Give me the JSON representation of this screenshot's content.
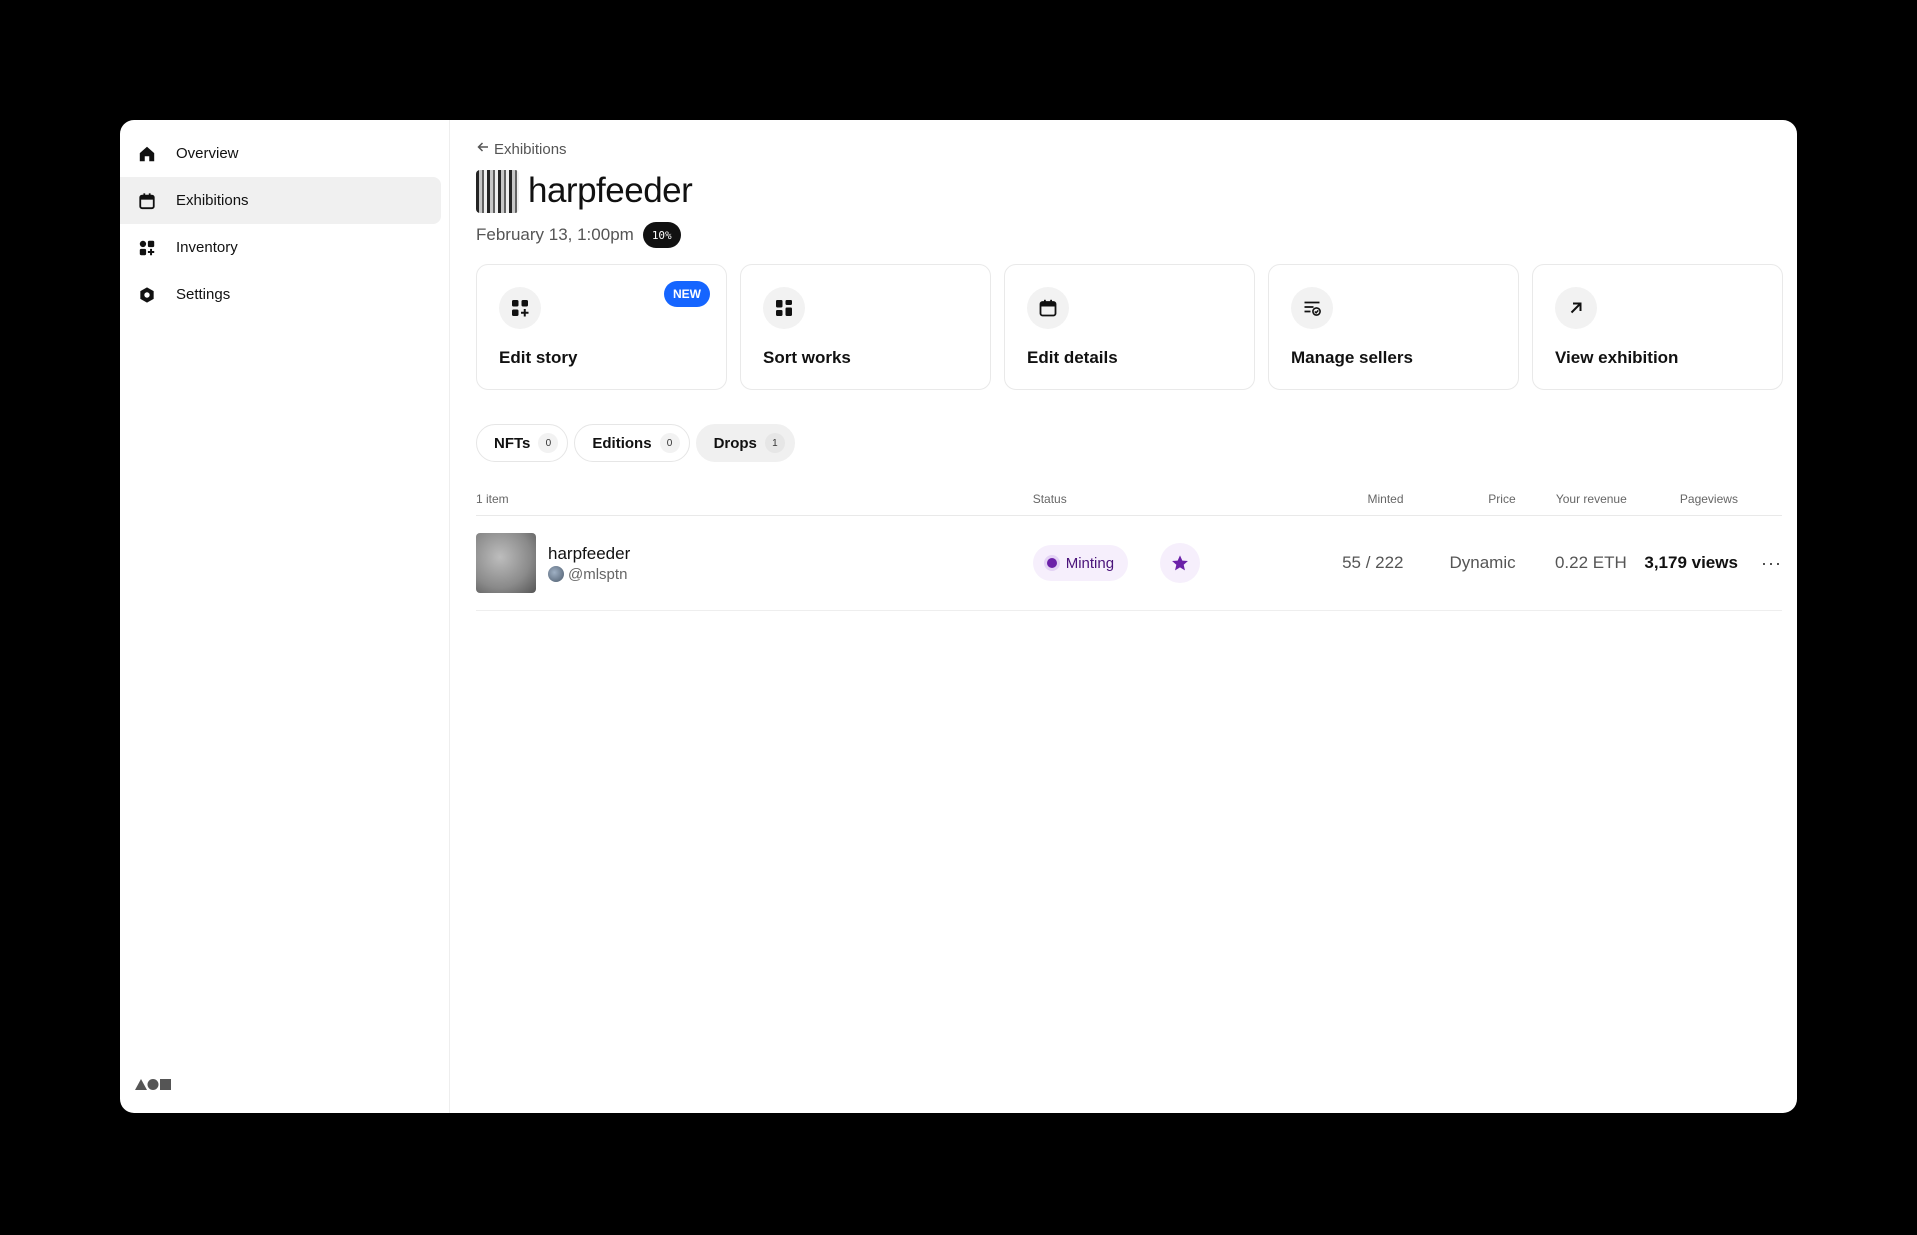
{
  "sidebar": {
    "items": [
      {
        "label": "Overview",
        "icon": "home-icon"
      },
      {
        "label": "Exhibitions",
        "icon": "calendar-icon"
      },
      {
        "label": "Inventory",
        "icon": "grid-icon"
      },
      {
        "label": "Settings",
        "icon": "gear-icon"
      }
    ],
    "active": "Exhibitions"
  },
  "header": {
    "back_label": "Exhibitions",
    "title": "harpfeeder",
    "date": "February 13, 1:00pm",
    "percent_badge": "10%"
  },
  "cards": [
    {
      "label": "Edit story",
      "badge": "NEW",
      "icon": "add-grid-icon"
    },
    {
      "label": "Sort works",
      "icon": "grid-icon"
    },
    {
      "label": "Edit details",
      "icon": "calendar-icon"
    },
    {
      "label": "Manage sellers",
      "icon": "list-check-icon"
    },
    {
      "label": "View exhibition",
      "icon": "arrow-up-right-icon"
    }
  ],
  "tabs": [
    {
      "label": "NFTs",
      "count": "0"
    },
    {
      "label": "Editions",
      "count": "0"
    },
    {
      "label": "Drops",
      "count": "1"
    }
  ],
  "active_tab": "Drops",
  "table": {
    "headers": {
      "item_count": "1 item",
      "status": "Status",
      "minted": "Minted",
      "price": "Price",
      "revenue": "Your revenue",
      "pageviews": "Pageviews"
    },
    "rows": [
      {
        "title": "harpfeeder",
        "user": "@mlsptn",
        "status": "Minting",
        "minted": "55 / 222",
        "price": "Dynamic",
        "revenue": "0.22 ETH",
        "pageviews": "3,179 views",
        "more": "···"
      }
    ]
  },
  "colors": {
    "accent_blue": "#1565ff",
    "status_purple": "#6b21a8",
    "status_bg": "#f6effc"
  }
}
